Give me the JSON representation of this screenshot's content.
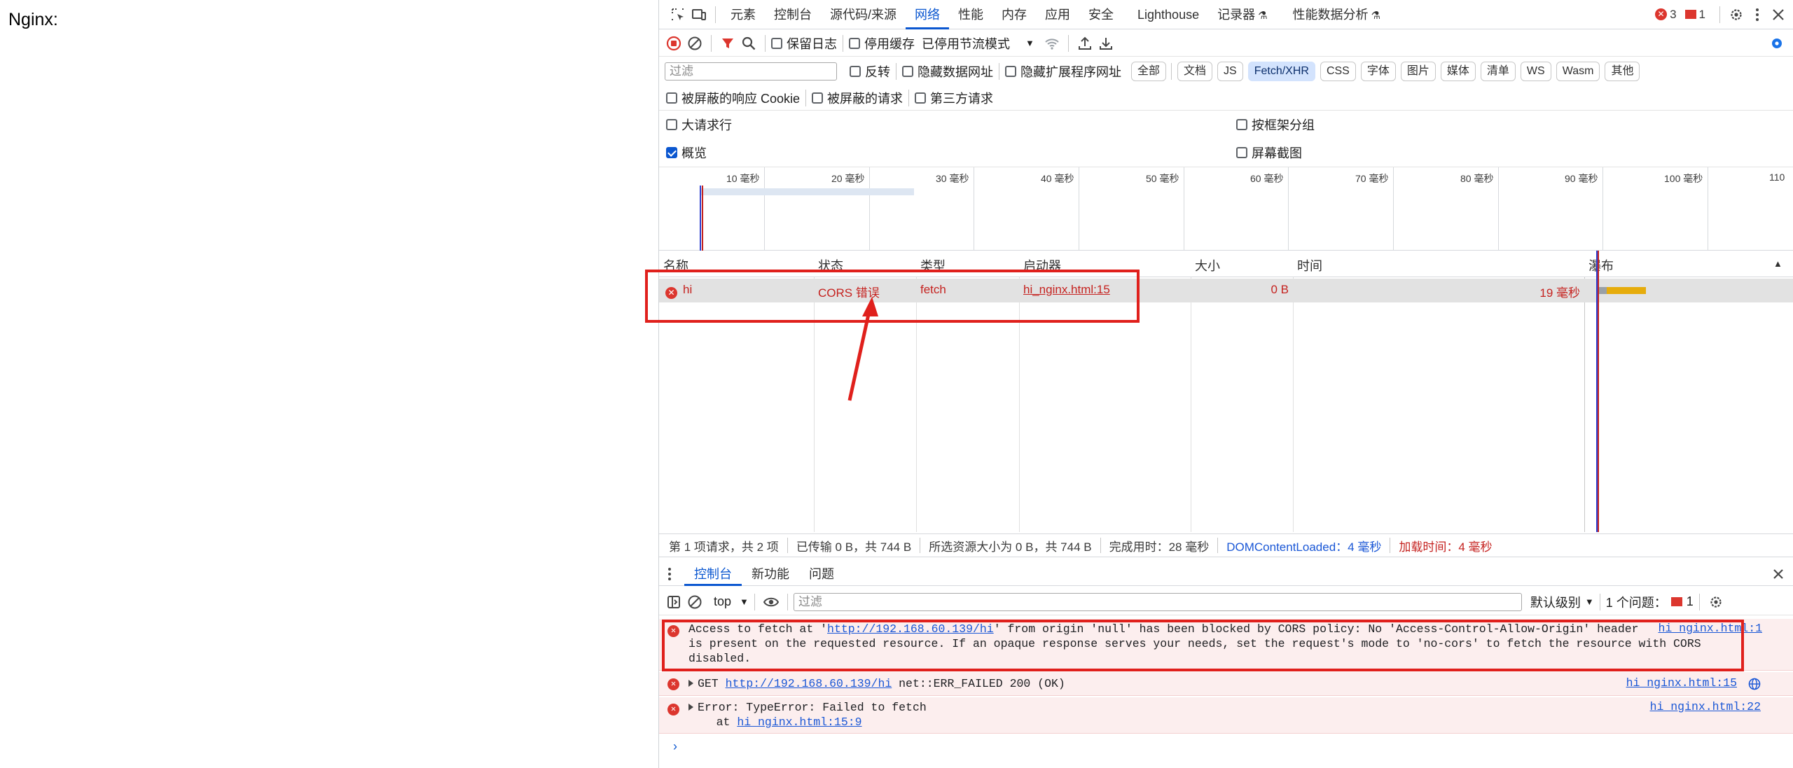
{
  "page": {
    "heading": "Nginx:"
  },
  "main_tabs": [
    {
      "label": "元素",
      "active": false
    },
    {
      "label": "控制台",
      "active": false
    },
    {
      "label": "源代码/来源",
      "active": false
    },
    {
      "label": "网络",
      "active": true
    },
    {
      "label": "性能",
      "active": false
    },
    {
      "label": "内存",
      "active": false
    },
    {
      "label": "应用",
      "active": false
    },
    {
      "label": "安全",
      "active": false
    },
    {
      "label": "Lighthouse",
      "active": false
    },
    {
      "label": "记录器",
      "active": false,
      "experimental": true
    },
    {
      "label": "性能数据分析",
      "active": false,
      "experimental": true
    }
  ],
  "counters": {
    "errors": "3",
    "issues": "1"
  },
  "network_toolbar": {
    "preserve_log": "保留日志",
    "disable_cache": "停用缓存",
    "throttling": "已停用节流模式"
  },
  "filter_bar": {
    "placeholder": "过滤",
    "invert": "反转",
    "hide_data_urls": "隐藏数据网址",
    "hide_extension_urls": "隐藏扩展程序网址",
    "chips": [
      {
        "label": "全部",
        "active": false
      },
      {
        "label": "文档",
        "active": false
      },
      {
        "label": "JS",
        "active": false
      },
      {
        "label": "Fetch/XHR",
        "active": true
      },
      {
        "label": "CSS",
        "active": false
      },
      {
        "label": "字体",
        "active": false
      },
      {
        "label": "图片",
        "active": false
      },
      {
        "label": "媒体",
        "active": false
      },
      {
        "label": "清单",
        "active": false
      },
      {
        "label": "WS",
        "active": false
      },
      {
        "label": "Wasm",
        "active": false
      },
      {
        "label": "其他",
        "active": false
      }
    ]
  },
  "cookie_bar": {
    "blocked_cookies": "被屏蔽的响应 Cookie",
    "blocked_requests": "被屏蔽的请求",
    "third_party": "第三方请求"
  },
  "options": {
    "big_rows": "大请求行",
    "group_by_frame": "按框架分组",
    "overview": "概览",
    "screenshots": "屏幕截图"
  },
  "overview_ticks": [
    "10 毫秒",
    "20 毫秒",
    "30 毫秒",
    "40 毫秒",
    "50 毫秒",
    "60 毫秒",
    "70 毫秒",
    "80 毫秒",
    "90 毫秒",
    "100 毫秒",
    "110"
  ],
  "table": {
    "headers": {
      "name": "名称",
      "status": "状态",
      "type": "类型",
      "initiator": "启动器",
      "size": "大小",
      "time": "时间",
      "waterfall": "瀑布"
    },
    "rows": [
      {
        "name": "hi",
        "status": "CORS 错误",
        "type": "fetch",
        "initiator": "hi_nginx.html:15",
        "size": "0 B",
        "time": "19 毫秒"
      }
    ]
  },
  "status_bar": {
    "requests": "第 1 项请求，共 2 项",
    "transferred": "已传输 0 B，共 744 B",
    "resources": "所选资源大小为 0 B，共 744 B",
    "finish": "完成用时：28 毫秒",
    "dom_loaded": "DOMContentLoaded：4 毫秒",
    "load": "加载时间：4 毫秒"
  },
  "drawer_tabs": [
    {
      "label": "控制台",
      "active": true
    },
    {
      "label": "新功能",
      "active": false
    },
    {
      "label": "问题",
      "active": false
    }
  ],
  "console_toolbar": {
    "context": "top",
    "filter_placeholder": "过滤",
    "levels": "默认级别",
    "issues": "1 个问题：",
    "issues_count": "1"
  },
  "console_messages": [
    {
      "level": "error",
      "line1_prefix": "Access to fetch at '",
      "line1_link": "http://192.168.60.139/hi",
      "line1_suffix": "' from origin 'null' has been blocked by CORS policy: No 'Access-Control-Allow-Origin' header",
      "line2": "is present on the requested resource. If an opaque response serves your needs, set the request's mode to 'no-cors' to fetch the resource with CORS",
      "line3": "disabled.",
      "source": "hi_nginx.html:1"
    },
    {
      "level": "error",
      "prefix": "GET ",
      "link": "http://192.168.60.139/hi",
      "suffix": " net::ERR_FAILED 200 (OK)",
      "source": "hi_nginx.html:15"
    },
    {
      "level": "error",
      "line1": "Error: TypeError: Failed to fetch",
      "line2_prefix": "    at ",
      "line2_link": "hi_nginx.html:15:9",
      "source": "hi_nginx.html:22"
    }
  ],
  "colors": {
    "accent": "#0b57d0",
    "error": "#dc362e",
    "annotation": "#e0201c",
    "selected_chip": "#d3e3fd"
  }
}
